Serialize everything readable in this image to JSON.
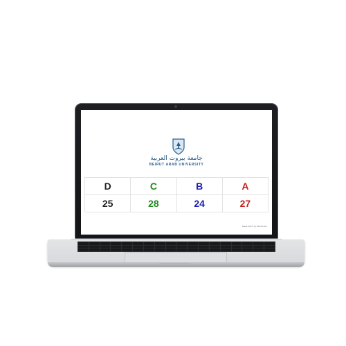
{
  "university": {
    "name_ar": "جامعة بيروت العربية",
    "name_en": "BEIRUT ARAB UNIVERSITY"
  },
  "grades": [
    {
      "label": "D",
      "count": "25",
      "color": "#222222"
    },
    {
      "label": "C",
      "count": "28",
      "color": "#1f8a1f"
    },
    {
      "label": "B",
      "count": "24",
      "color": "#1a1fb0"
    },
    {
      "label": "A",
      "count": "27",
      "color": "#c81e1e"
    }
  ],
  "credit": "Made with ♥ by Mentimeter",
  "colors": {
    "brand": "#2a5d8a"
  }
}
